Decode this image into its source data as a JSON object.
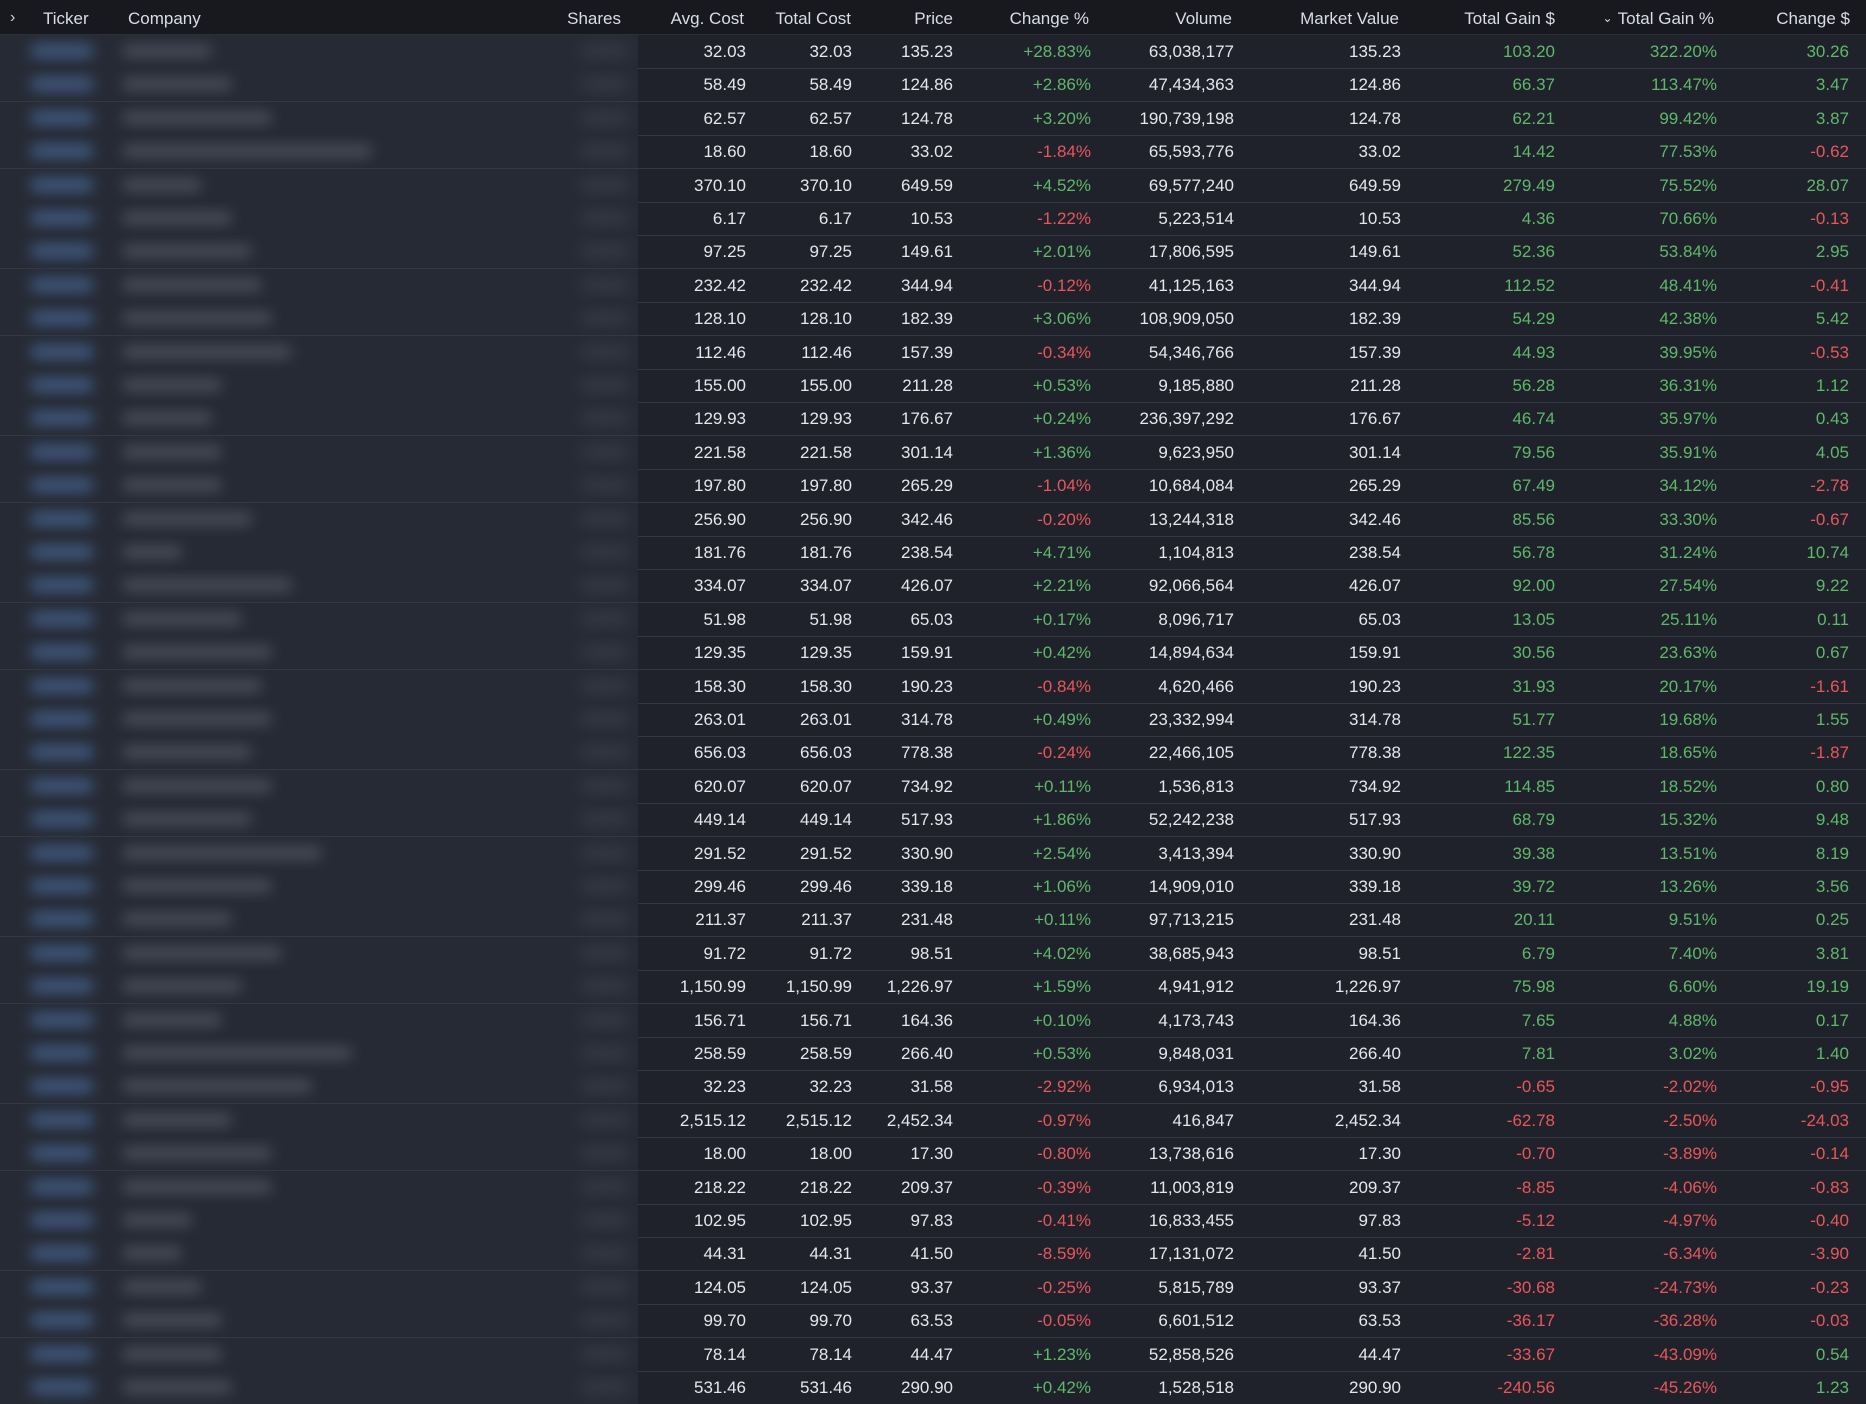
{
  "columns": {
    "expand_icon": "chevron-right-icon",
    "ticker": "Ticker",
    "company": "Company",
    "shares": "Shares",
    "avg_cost": "Avg. Cost",
    "total_cost": "Total Cost",
    "price": "Price",
    "change_pct": "Change %",
    "volume": "Volume",
    "market_value": "Market Value",
    "total_gain_usd": "Total Gain $",
    "total_gain_pct": "Total Gain %",
    "change_usd": "Change $",
    "sort_indicator": "chevron-down-icon"
  },
  "colors": {
    "positive": "#5fb86a",
    "negative": "#e8565a",
    "background": "#1f222b",
    "header_bg": "#17191f",
    "text": "#e4e7ec"
  },
  "rows": [
    {
      "avg_cost": "32.03",
      "total_cost": "32.03",
      "price": "135.23",
      "change_pct": "+28.83%",
      "volume": "63,038,177",
      "market_value": "135.23",
      "total_gain_usd": "103.20",
      "total_gain_pct": "322.20%",
      "change_usd": "30.26"
    },
    {
      "avg_cost": "58.49",
      "total_cost": "58.49",
      "price": "124.86",
      "change_pct": "+2.86%",
      "volume": "47,434,363",
      "market_value": "124.86",
      "total_gain_usd": "66.37",
      "total_gain_pct": "113.47%",
      "change_usd": "3.47"
    },
    {
      "avg_cost": "62.57",
      "total_cost": "62.57",
      "price": "124.78",
      "change_pct": "+3.20%",
      "volume": "190,739,198",
      "market_value": "124.78",
      "total_gain_usd": "62.21",
      "total_gain_pct": "99.42%",
      "change_usd": "3.87"
    },
    {
      "avg_cost": "18.60",
      "total_cost": "18.60",
      "price": "33.02",
      "change_pct": "-1.84%",
      "volume": "65,593,776",
      "market_value": "33.02",
      "total_gain_usd": "14.42",
      "total_gain_pct": "77.53%",
      "change_usd": "-0.62"
    },
    {
      "avg_cost": "370.10",
      "total_cost": "370.10",
      "price": "649.59",
      "change_pct": "+4.52%",
      "volume": "69,577,240",
      "market_value": "649.59",
      "total_gain_usd": "279.49",
      "total_gain_pct": "75.52%",
      "change_usd": "28.07"
    },
    {
      "avg_cost": "6.17",
      "total_cost": "6.17",
      "price": "10.53",
      "change_pct": "-1.22%",
      "volume": "5,223,514",
      "market_value": "10.53",
      "total_gain_usd": "4.36",
      "total_gain_pct": "70.66%",
      "change_usd": "-0.13"
    },
    {
      "avg_cost": "97.25",
      "total_cost": "97.25",
      "price": "149.61",
      "change_pct": "+2.01%",
      "volume": "17,806,595",
      "market_value": "149.61",
      "total_gain_usd": "52.36",
      "total_gain_pct": "53.84%",
      "change_usd": "2.95"
    },
    {
      "avg_cost": "232.42",
      "total_cost": "232.42",
      "price": "344.94",
      "change_pct": "-0.12%",
      "volume": "41,125,163",
      "market_value": "344.94",
      "total_gain_usd": "112.52",
      "total_gain_pct": "48.41%",
      "change_usd": "-0.41"
    },
    {
      "avg_cost": "128.10",
      "total_cost": "128.10",
      "price": "182.39",
      "change_pct": "+3.06%",
      "volume": "108,909,050",
      "market_value": "182.39",
      "total_gain_usd": "54.29",
      "total_gain_pct": "42.38%",
      "change_usd": "5.42"
    },
    {
      "avg_cost": "112.46",
      "total_cost": "112.46",
      "price": "157.39",
      "change_pct": "-0.34%",
      "volume": "54,346,766",
      "market_value": "157.39",
      "total_gain_usd": "44.93",
      "total_gain_pct": "39.95%",
      "change_usd": "-0.53"
    },
    {
      "avg_cost": "155.00",
      "total_cost": "155.00",
      "price": "211.28",
      "change_pct": "+0.53%",
      "volume": "9,185,880",
      "market_value": "211.28",
      "total_gain_usd": "56.28",
      "total_gain_pct": "36.31%",
      "change_usd": "1.12"
    },
    {
      "avg_cost": "129.93",
      "total_cost": "129.93",
      "price": "176.67",
      "change_pct": "+0.24%",
      "volume": "236,397,292",
      "market_value": "176.67",
      "total_gain_usd": "46.74",
      "total_gain_pct": "35.97%",
      "change_usd": "0.43"
    },
    {
      "avg_cost": "221.58",
      "total_cost": "221.58",
      "price": "301.14",
      "change_pct": "+1.36%",
      "volume": "9,623,950",
      "market_value": "301.14",
      "total_gain_usd": "79.56",
      "total_gain_pct": "35.91%",
      "change_usd": "4.05"
    },
    {
      "avg_cost": "197.80",
      "total_cost": "197.80",
      "price": "265.29",
      "change_pct": "-1.04%",
      "volume": "10,684,084",
      "market_value": "265.29",
      "total_gain_usd": "67.49",
      "total_gain_pct": "34.12%",
      "change_usd": "-2.78"
    },
    {
      "avg_cost": "256.90",
      "total_cost": "256.90",
      "price": "342.46",
      "change_pct": "-0.20%",
      "volume": "13,244,318",
      "market_value": "342.46",
      "total_gain_usd": "85.56",
      "total_gain_pct": "33.30%",
      "change_usd": "-0.67"
    },
    {
      "avg_cost": "181.76",
      "total_cost": "181.76",
      "price": "238.54",
      "change_pct": "+4.71%",
      "volume": "1,104,813",
      "market_value": "238.54",
      "total_gain_usd": "56.78",
      "total_gain_pct": "31.24%",
      "change_usd": "10.74"
    },
    {
      "avg_cost": "334.07",
      "total_cost": "334.07",
      "price": "426.07",
      "change_pct": "+2.21%",
      "volume": "92,066,564",
      "market_value": "426.07",
      "total_gain_usd": "92.00",
      "total_gain_pct": "27.54%",
      "change_usd": "9.22"
    },
    {
      "avg_cost": "51.98",
      "total_cost": "51.98",
      "price": "65.03",
      "change_pct": "+0.17%",
      "volume": "8,096,717",
      "market_value": "65.03",
      "total_gain_usd": "13.05",
      "total_gain_pct": "25.11%",
      "change_usd": "0.11"
    },
    {
      "avg_cost": "129.35",
      "total_cost": "129.35",
      "price": "159.91",
      "change_pct": "+0.42%",
      "volume": "14,894,634",
      "market_value": "159.91",
      "total_gain_usd": "30.56",
      "total_gain_pct": "23.63%",
      "change_usd": "0.67"
    },
    {
      "avg_cost": "158.30",
      "total_cost": "158.30",
      "price": "190.23",
      "change_pct": "-0.84%",
      "volume": "4,620,466",
      "market_value": "190.23",
      "total_gain_usd": "31.93",
      "total_gain_pct": "20.17%",
      "change_usd": "-1.61"
    },
    {
      "avg_cost": "263.01",
      "total_cost": "263.01",
      "price": "314.78",
      "change_pct": "+0.49%",
      "volume": "23,332,994",
      "market_value": "314.78",
      "total_gain_usd": "51.77",
      "total_gain_pct": "19.68%",
      "change_usd": "1.55"
    },
    {
      "avg_cost": "656.03",
      "total_cost": "656.03",
      "price": "778.38",
      "change_pct": "-0.24%",
      "volume": "22,466,105",
      "market_value": "778.38",
      "total_gain_usd": "122.35",
      "total_gain_pct": "18.65%",
      "change_usd": "-1.87"
    },
    {
      "avg_cost": "620.07",
      "total_cost": "620.07",
      "price": "734.92",
      "change_pct": "+0.11%",
      "volume": "1,536,813",
      "market_value": "734.92",
      "total_gain_usd": "114.85",
      "total_gain_pct": "18.52%",
      "change_usd": "0.80"
    },
    {
      "avg_cost": "449.14",
      "total_cost": "449.14",
      "price": "517.93",
      "change_pct": "+1.86%",
      "volume": "52,242,238",
      "market_value": "517.93",
      "total_gain_usd": "68.79",
      "total_gain_pct": "15.32%",
      "change_usd": "9.48"
    },
    {
      "avg_cost": "291.52",
      "total_cost": "291.52",
      "price": "330.90",
      "change_pct": "+2.54%",
      "volume": "3,413,394",
      "market_value": "330.90",
      "total_gain_usd": "39.38",
      "total_gain_pct": "13.51%",
      "change_usd": "8.19"
    },
    {
      "avg_cost": "299.46",
      "total_cost": "299.46",
      "price": "339.18",
      "change_pct": "+1.06%",
      "volume": "14,909,010",
      "market_value": "339.18",
      "total_gain_usd": "39.72",
      "total_gain_pct": "13.26%",
      "change_usd": "3.56"
    },
    {
      "avg_cost": "211.37",
      "total_cost": "211.37",
      "price": "231.48",
      "change_pct": "+0.11%",
      "volume": "97,713,215",
      "market_value": "231.48",
      "total_gain_usd": "20.11",
      "total_gain_pct": "9.51%",
      "change_usd": "0.25"
    },
    {
      "avg_cost": "91.72",
      "total_cost": "91.72",
      "price": "98.51",
      "change_pct": "+4.02%",
      "volume": "38,685,943",
      "market_value": "98.51",
      "total_gain_usd": "6.79",
      "total_gain_pct": "7.40%",
      "change_usd": "3.81"
    },
    {
      "avg_cost": "1,150.99",
      "total_cost": "1,150.99",
      "price": "1,226.97",
      "change_pct": "+1.59%",
      "volume": "4,941,912",
      "market_value": "1,226.97",
      "total_gain_usd": "75.98",
      "total_gain_pct": "6.60%",
      "change_usd": "19.19"
    },
    {
      "avg_cost": "156.71",
      "total_cost": "156.71",
      "price": "164.36",
      "change_pct": "+0.10%",
      "volume": "4,173,743",
      "market_value": "164.36",
      "total_gain_usd": "7.65",
      "total_gain_pct": "4.88%",
      "change_usd": "0.17"
    },
    {
      "avg_cost": "258.59",
      "total_cost": "258.59",
      "price": "266.40",
      "change_pct": "+0.53%",
      "volume": "9,848,031",
      "market_value": "266.40",
      "total_gain_usd": "7.81",
      "total_gain_pct": "3.02%",
      "change_usd": "1.40"
    },
    {
      "avg_cost": "32.23",
      "total_cost": "32.23",
      "price": "31.58",
      "change_pct": "-2.92%",
      "volume": "6,934,013",
      "market_value": "31.58",
      "total_gain_usd": "-0.65",
      "total_gain_pct": "-2.02%",
      "change_usd": "-0.95"
    },
    {
      "avg_cost": "2,515.12",
      "total_cost": "2,515.12",
      "price": "2,452.34",
      "change_pct": "-0.97%",
      "volume": "416,847",
      "market_value": "2,452.34",
      "total_gain_usd": "-62.78",
      "total_gain_pct": "-2.50%",
      "change_usd": "-24.03"
    },
    {
      "avg_cost": "18.00",
      "total_cost": "18.00",
      "price": "17.30",
      "change_pct": "-0.80%",
      "volume": "13,738,616",
      "market_value": "17.30",
      "total_gain_usd": "-0.70",
      "total_gain_pct": "-3.89%",
      "change_usd": "-0.14"
    },
    {
      "avg_cost": "218.22",
      "total_cost": "218.22",
      "price": "209.37",
      "change_pct": "-0.39%",
      "volume": "11,003,819",
      "market_value": "209.37",
      "total_gain_usd": "-8.85",
      "total_gain_pct": "-4.06%",
      "change_usd": "-0.83"
    },
    {
      "avg_cost": "102.95",
      "total_cost": "102.95",
      "price": "97.83",
      "change_pct": "-0.41%",
      "volume": "16,833,455",
      "market_value": "97.83",
      "total_gain_usd": "-5.12",
      "total_gain_pct": "-4.97%",
      "change_usd": "-0.40"
    },
    {
      "avg_cost": "44.31",
      "total_cost": "44.31",
      "price": "41.50",
      "change_pct": "-8.59%",
      "volume": "17,131,072",
      "market_value": "41.50",
      "total_gain_usd": "-2.81",
      "total_gain_pct": "-6.34%",
      "change_usd": "-3.90"
    },
    {
      "avg_cost": "124.05",
      "total_cost": "124.05",
      "price": "93.37",
      "change_pct": "-0.25%",
      "volume": "5,815,789",
      "market_value": "93.37",
      "total_gain_usd": "-30.68",
      "total_gain_pct": "-24.73%",
      "change_usd": "-0.23"
    },
    {
      "avg_cost": "99.70",
      "total_cost": "99.70",
      "price": "63.53",
      "change_pct": "-0.05%",
      "volume": "6,601,512",
      "market_value": "63.53",
      "total_gain_usd": "-36.17",
      "total_gain_pct": "-36.28%",
      "change_usd": "-0.03"
    },
    {
      "avg_cost": "78.14",
      "total_cost": "78.14",
      "price": "44.47",
      "change_pct": "+1.23%",
      "volume": "52,858,526",
      "market_value": "44.47",
      "total_gain_usd": "-33.67",
      "total_gain_pct": "-43.09%",
      "change_usd": "0.54"
    },
    {
      "avg_cost": "531.46",
      "total_cost": "531.46",
      "price": "290.90",
      "change_pct": "+0.42%",
      "volume": "1,528,518",
      "market_value": "290.90",
      "total_gain_usd": "-240.56",
      "total_gain_pct": "-45.26%",
      "change_usd": "1.23"
    }
  ]
}
